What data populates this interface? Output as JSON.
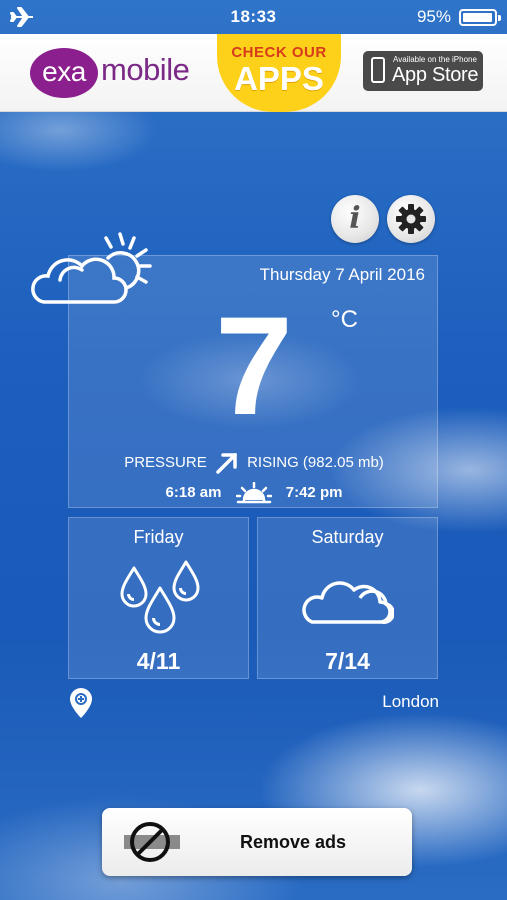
{
  "status_bar": {
    "time": "18:33",
    "battery": "95%",
    "airplane_icon": "airplane-icon"
  },
  "ad": {
    "brand_prefix": "exa",
    "brand_suffix": "mobile",
    "cta_line1": "CHECK OUR",
    "cta_line2": "APPS",
    "store_small": "Available on the iPhone",
    "store_big": "App Store",
    "colors": {
      "brand": "#8a1f8d",
      "cta_bg": "#fdd11a",
      "cta_text": "#d63b1b"
    }
  },
  "buttons": {
    "info_icon": "info-icon",
    "settings_icon": "gear-icon",
    "info_glyph": "i"
  },
  "current": {
    "condition_icon": "cloud-sun-icon",
    "date": "Thursday 7 April 2016",
    "temperature": "7",
    "unit": "°C",
    "pressure_label": "PRESSURE",
    "pressure_trend_icon": "arrow-up-right-icon",
    "pressure_value": "RISING (982.05 mb)",
    "sunrise": "6:18 am",
    "sunset": "7:42 pm",
    "sun_icon": "sunrise-icon"
  },
  "forecast": [
    {
      "day": "Friday",
      "icon": "rain-drops-icon",
      "range": "4/11"
    },
    {
      "day": "Saturday",
      "icon": "cloud-icon",
      "range": "7/14"
    }
  ],
  "location": {
    "icon": "location-pin-icon",
    "city": "London"
  },
  "remove_ads": {
    "label": "Remove ads",
    "icon": "no-ads-icon"
  }
}
